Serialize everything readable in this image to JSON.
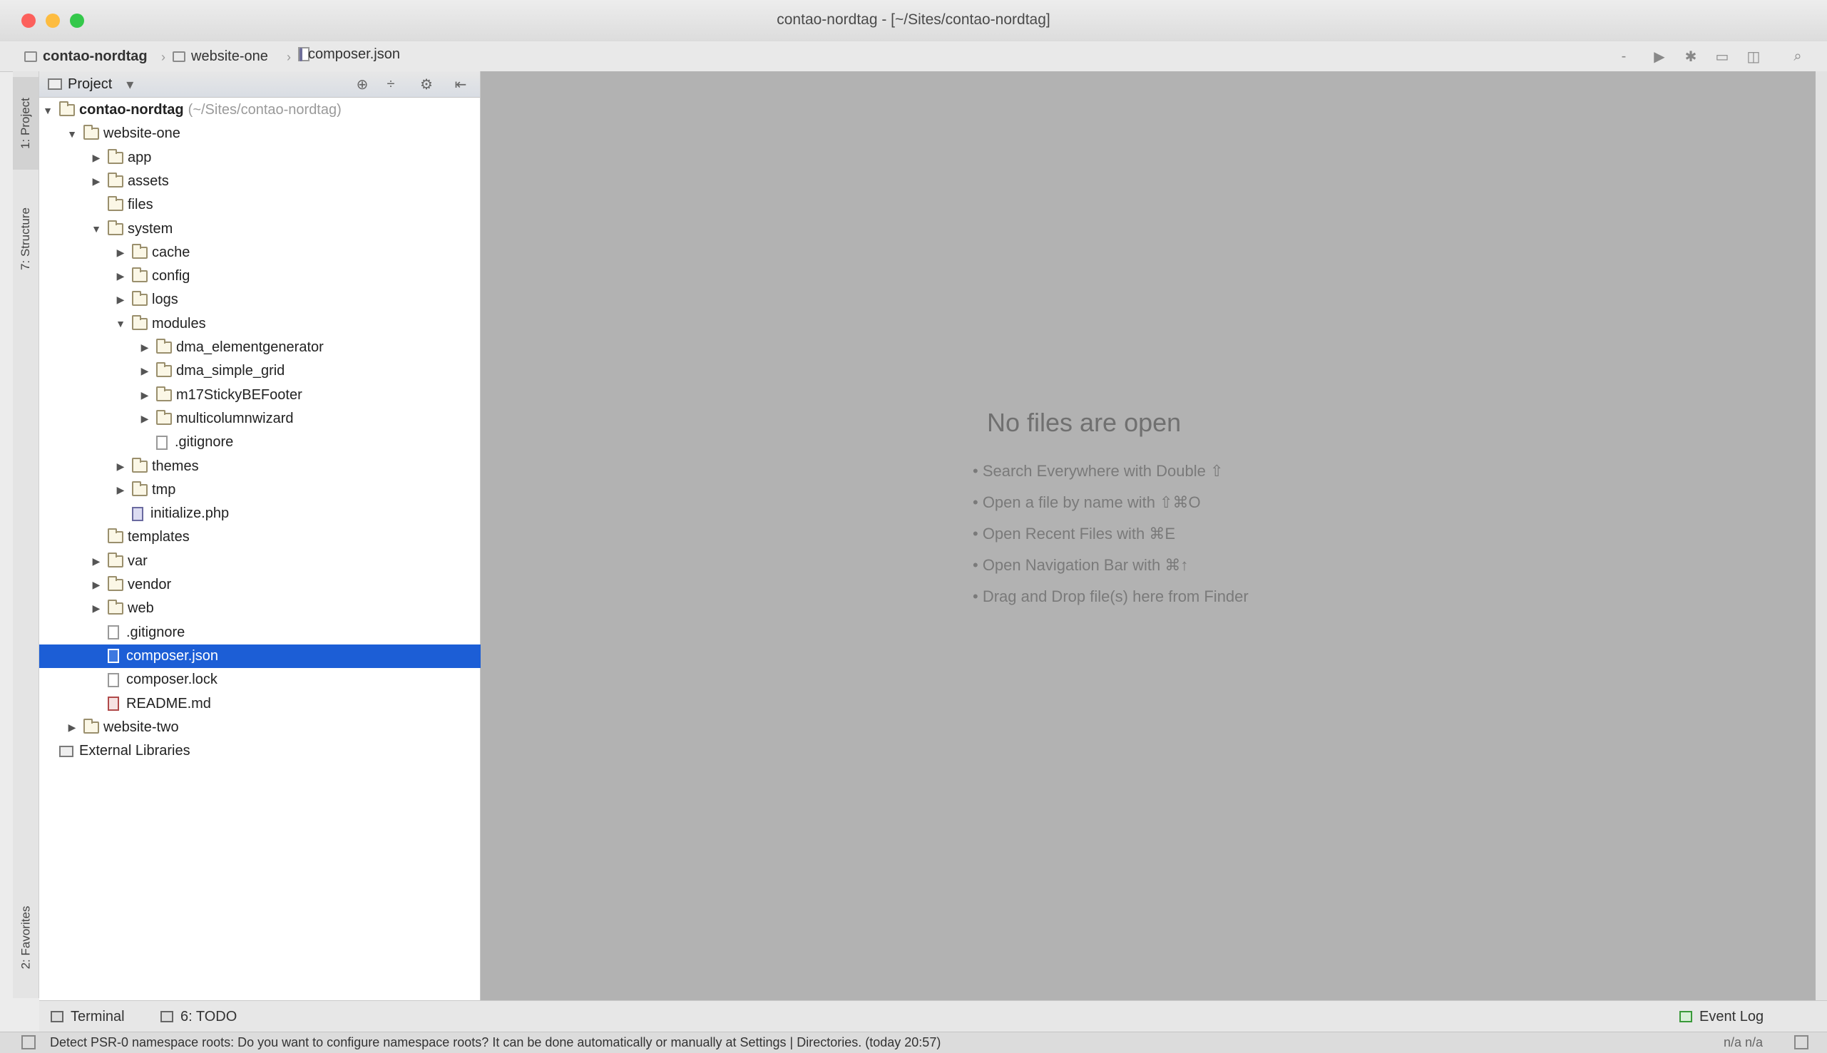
{
  "window": {
    "title": "contao-nordtag - [~/Sites/contao-nordtag]",
    "traffic_colors": {
      "close": "#fc605c",
      "minimize": "#fdbc40",
      "zoom": "#34c84a"
    }
  },
  "navbar": {
    "crumbs": [
      "contao-nordtag",
      "website-one",
      "composer.json"
    ]
  },
  "toolbar": {
    "icons": [
      "dropdown-icon",
      "run-icon",
      "debug-icon",
      "coverage-icon",
      "stop-icon",
      "search-icon"
    ],
    "dropdown": "-",
    "run": "▶",
    "debug": "✱",
    "coverage": "▭",
    "stop": "◫",
    "search": "⌕"
  },
  "left_tabs": {
    "project": "1: Project",
    "structure": "7: Structure",
    "favorites": "2: Favorites"
  },
  "project_panel": {
    "title": "Project",
    "dropdown": "▾",
    "icons": {
      "locate": "⊕",
      "collapse": "÷",
      "settings": "⚙",
      "hide": "⇤"
    },
    "tree": [
      {
        "label": "contao-nordtag",
        "extra": "(~/Sites/contao-nordtag)",
        "type": "folder",
        "depth": 0,
        "arrow": "down",
        "bold": true
      },
      {
        "label": "website-one",
        "type": "folder",
        "depth": 1,
        "arrow": "down"
      },
      {
        "label": "app",
        "type": "folder",
        "depth": 2,
        "arrow": "right"
      },
      {
        "label": "assets",
        "type": "folder",
        "depth": 2,
        "arrow": "right"
      },
      {
        "label": "files",
        "type": "folder",
        "depth": 2,
        "arrow": "none"
      },
      {
        "label": "system",
        "type": "folder",
        "depth": 2,
        "arrow": "down"
      },
      {
        "label": "cache",
        "type": "folder",
        "depth": 3,
        "arrow": "right"
      },
      {
        "label": "config",
        "type": "folder",
        "depth": 3,
        "arrow": "right"
      },
      {
        "label": "logs",
        "type": "folder",
        "depth": 3,
        "arrow": "right"
      },
      {
        "label": "modules",
        "type": "folder",
        "depth": 3,
        "arrow": "down"
      },
      {
        "label": "dma_elementgenerator",
        "type": "folder",
        "depth": 4,
        "arrow": "right"
      },
      {
        "label": "dma_simple_grid",
        "type": "folder",
        "depth": 4,
        "arrow": "right"
      },
      {
        "label": "m17StickyBEFooter",
        "type": "folder",
        "depth": 4,
        "arrow": "right"
      },
      {
        "label": "multicolumnwizard",
        "type": "folder",
        "depth": 4,
        "arrow": "right"
      },
      {
        "label": ".gitignore",
        "type": "file",
        "depth": 4,
        "arrow": "none"
      },
      {
        "label": "themes",
        "type": "folder",
        "depth": 3,
        "arrow": "right"
      },
      {
        "label": "tmp",
        "type": "folder",
        "depth": 3,
        "arrow": "right"
      },
      {
        "label": "initialize.php",
        "type": "php",
        "depth": 3,
        "arrow": "none"
      },
      {
        "label": "templates",
        "type": "folder",
        "depth": 2,
        "arrow": "none"
      },
      {
        "label": "var",
        "type": "folder",
        "depth": 2,
        "arrow": "right"
      },
      {
        "label": "vendor",
        "type": "folder",
        "depth": 2,
        "arrow": "right"
      },
      {
        "label": "web",
        "type": "folder",
        "depth": 2,
        "arrow": "right"
      },
      {
        "label": ".gitignore",
        "type": "file",
        "depth": 2,
        "arrow": "none"
      },
      {
        "label": "composer.json",
        "type": "json",
        "depth": 2,
        "arrow": "none",
        "selected": true
      },
      {
        "label": "composer.lock",
        "type": "file",
        "depth": 2,
        "arrow": "none"
      },
      {
        "label": "README.md",
        "type": "md",
        "depth": 2,
        "arrow": "none"
      },
      {
        "label": "website-two",
        "type": "folder",
        "depth": 1,
        "arrow": "right"
      },
      {
        "label": "External Libraries",
        "type": "lib",
        "depth": 0,
        "arrow": "none"
      }
    ]
  },
  "editor": {
    "empty_title": "No files are open",
    "hints": [
      "• Search Everywhere with Double ⇧",
      "• Open a file by name with ⇧⌘O",
      "• Open Recent Files with ⌘E",
      "• Open Navigation Bar with ⌘↑",
      "• Drag and Drop file(s) here from Finder"
    ]
  },
  "bottom_tabs": {
    "terminal": "Terminal",
    "todo": "6: TODO",
    "event_log": "Event Log"
  },
  "status": {
    "message": "Detect PSR-0 namespace roots: Do you want to configure namespace roots? It can be done automatically or manually at Settings | Directories. (today 20:57)",
    "position": "n/a n/a"
  }
}
